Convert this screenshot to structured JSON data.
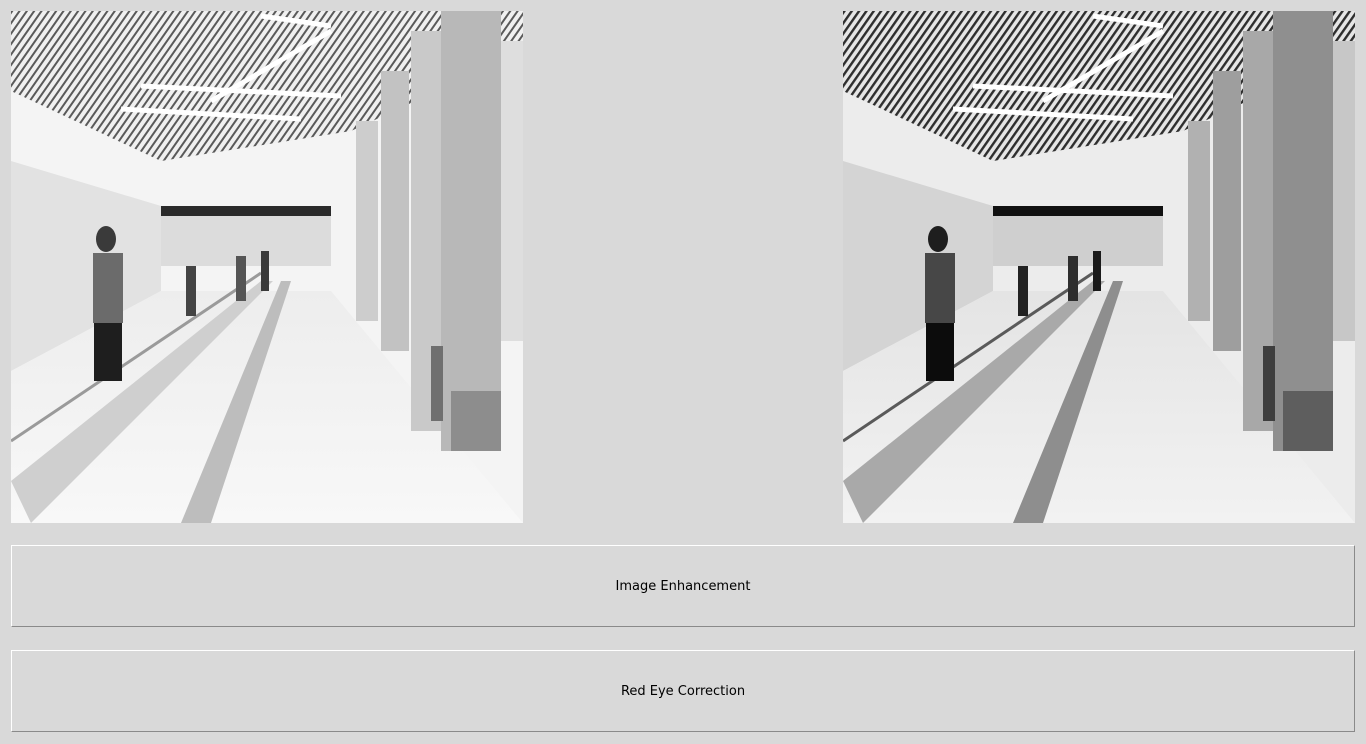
{
  "images": {
    "original": {
      "icon": "airport-walkway-photo-original",
      "tone": "bright-grayscale"
    },
    "processed": {
      "icon": "airport-walkway-photo-enhanced",
      "tone": "contrast-grayscale"
    }
  },
  "buttons": {
    "enhance_label": "Image Enhancement",
    "redeye_label": "Red Eye Correction"
  },
  "colors": {
    "window_bg": "#d9d9d9",
    "button_bg": "#d9d9d9",
    "button_text": "#000000"
  }
}
